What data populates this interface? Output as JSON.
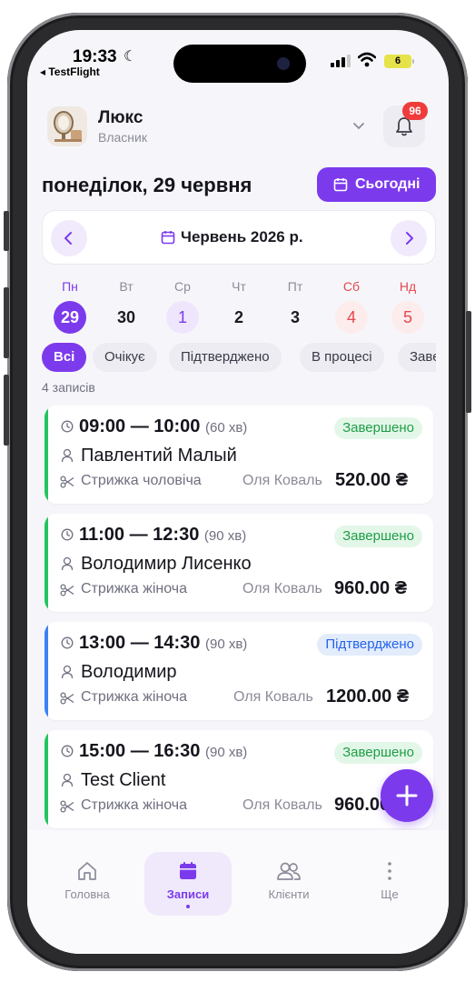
{
  "status_bar": {
    "time": "19:33",
    "back_app": "◂ TestFlight",
    "battery": "6"
  },
  "header": {
    "business_name": "Люкс",
    "role": "Власник",
    "notifications_count": "96"
  },
  "date_title": "понеділок, 29 червня",
  "today_button": "Сьогодні",
  "month_nav": {
    "label": "Червень 2026 р."
  },
  "week": [
    {
      "name": "Пн",
      "date": "29",
      "state": "selected"
    },
    {
      "name": "Вт",
      "date": "30",
      "state": "normal"
    },
    {
      "name": "Ср",
      "date": "1",
      "state": "today"
    },
    {
      "name": "Чт",
      "date": "2",
      "state": "normal"
    },
    {
      "name": "Пт",
      "date": "3",
      "state": "normal"
    },
    {
      "name": "Сб",
      "date": "4",
      "state": "weekend"
    },
    {
      "name": "Нд",
      "date": "5",
      "state": "weekend"
    }
  ],
  "filters": [
    "Всі",
    "Очікує",
    "Підтверджено",
    "В процесі",
    "Завершено"
  ],
  "records_count": "4 записів",
  "appointments": [
    {
      "time": "09:00 — 10:00",
      "duration": "(60 хв)",
      "status": "Завершено",
      "status_type": "done",
      "client": "Павлентий Малый",
      "service": "Стрижка чоловіча",
      "staff": "Оля Коваль",
      "price": "520.00 ₴"
    },
    {
      "time": "11:00 — 12:30",
      "duration": "(90 хв)",
      "status": "Завершено",
      "status_type": "done",
      "client": "Володимир Лисенко",
      "service": "Стрижка жіноча",
      "staff": "Оля Коваль",
      "price": "960.00 ₴"
    },
    {
      "time": "13:00 — 14:30",
      "duration": "(90 хв)",
      "status": "Підтверджено",
      "status_type": "confirmed",
      "client": "Володимир",
      "service": "Стрижка жіноча",
      "staff": "Оля Коваль",
      "price": "1200.00 ₴"
    },
    {
      "time": "15:00 — 16:30",
      "duration": "(90 хв)",
      "status": "Завершено",
      "status_type": "done",
      "client": "Test Client",
      "service": "Стрижка жіноча",
      "staff": "Оля Коваль",
      "price": "960.00 ₴"
    }
  ],
  "tabs": [
    {
      "label": "Головна",
      "icon": "home-icon"
    },
    {
      "label": "Записи",
      "icon": "calendar-icon"
    },
    {
      "label": "Клієнти",
      "icon": "users-icon"
    },
    {
      "label": "Ще",
      "icon": "more-icon"
    }
  ],
  "colors": {
    "accent": "#7c3aed",
    "done_bar": "#22c55e",
    "done_pill_bg": "#e3f7e8",
    "done_pill_text": "#1f9d48",
    "confirmed_bar": "#3b82f6",
    "confirmed_pill_bg": "#e3ecfb",
    "confirmed_pill_text": "#2563eb",
    "weekend": "#e5484d",
    "weekend_bg": "#fdecec",
    "today_bg": "#efe6fd"
  }
}
